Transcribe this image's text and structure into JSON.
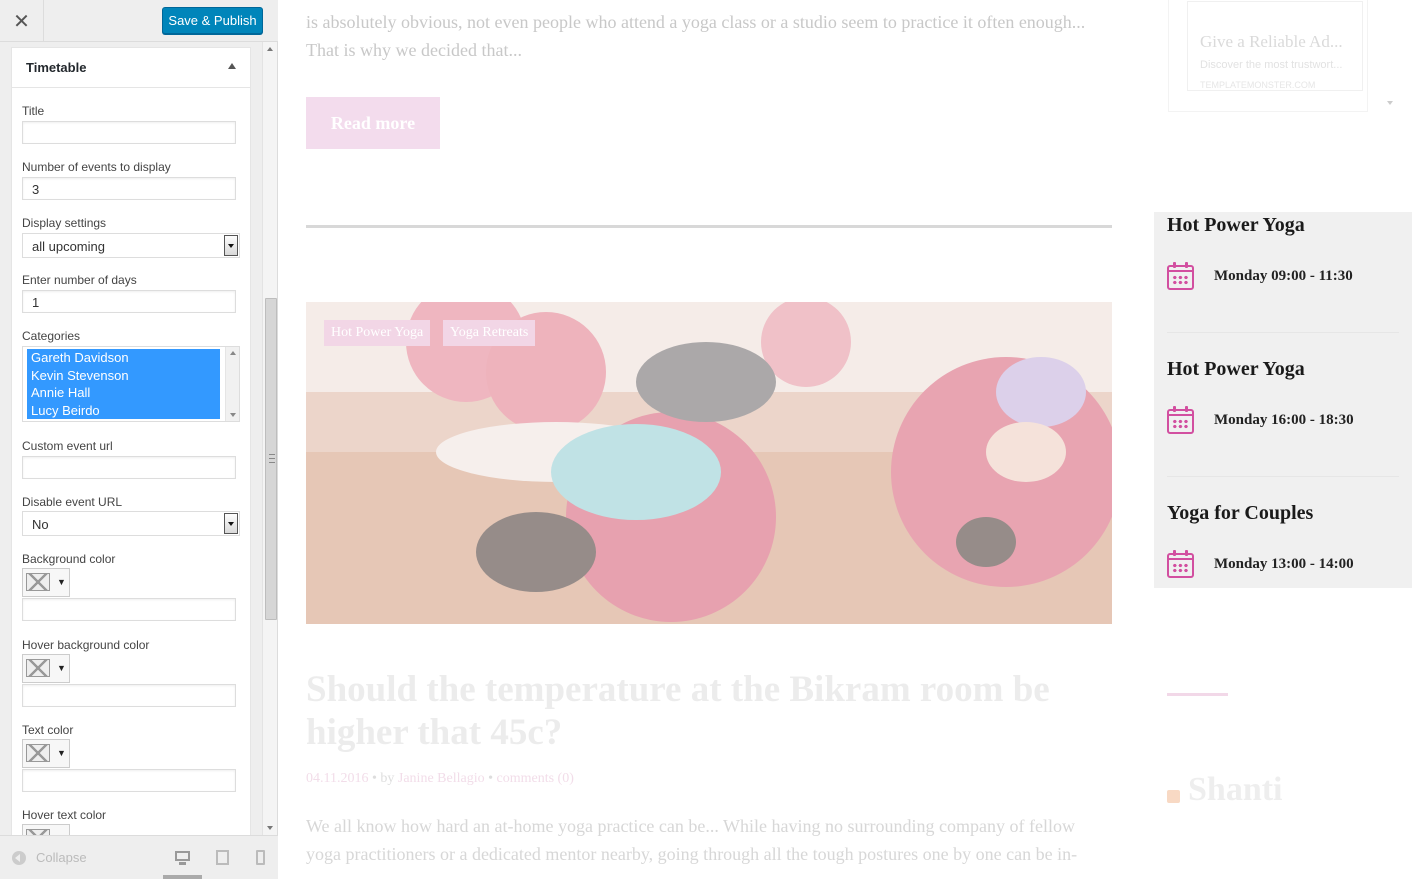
{
  "toolbar": {
    "close_icon": "close-icon",
    "publish_label": "Save & Publish",
    "accent_color": "#0085ba"
  },
  "widget": {
    "title": "Timetable",
    "fields": {
      "title_label": "Title",
      "title_value": "",
      "events_label": "Number of events to display",
      "events_value": "3",
      "display_label": "Display settings",
      "display_value": "all upcoming",
      "days_label": "Enter number of days",
      "days_value": "1",
      "categories_label": "Categories",
      "categories": [
        "Gareth Davidson",
        "Kevin Stevenson",
        "Annie Hall",
        "Lucy Beirdo"
      ],
      "custom_url_label": "Custom event url",
      "custom_url_value": "",
      "disable_url_label": "Disable event URL",
      "disable_url_value": "No",
      "bg_color_label": "Background color",
      "hover_bg_color_label": "Hover background color",
      "text_color_label": "Text color",
      "hover_text_color_label": "Hover text color"
    }
  },
  "footer": {
    "collapse_label": "Collapse",
    "devices": [
      "desktop-icon",
      "tablet-icon",
      "mobile-icon"
    ]
  },
  "preview": {
    "intro_lines": [
      "is absolutely obvious, not even people who attend a yoga class or a studio seem to practice it often enough...",
      "That is why we decided that..."
    ],
    "read_more": "Read more",
    "tags": [
      "Hot Power Yoga",
      "Yoga Retreats"
    ],
    "post_title": "Should the temperature at the Bikram room be higher that 45c?",
    "post_meta": {
      "date": "04.11.2016",
      "by": "by",
      "author": "Janine Bellagio",
      "comments": "comments (0)"
    },
    "excerpt": "We all know how hard an at-home yoga practice can be... While having no surrounding company of fellow yoga practitioners or a dedicated mentor nearby, going through all the tough postures one by one can be in-",
    "ad": {
      "title": "Give a Reliable Ad...",
      "desc": "Discover the most trustwort...",
      "url": "TEMPLATEMONSTER.COM"
    },
    "timetable": [
      {
        "title": "Hot Power Yoga",
        "time": "Monday 09:00 - 11:30"
      },
      {
        "title": "Hot Power Yoga",
        "time": "Monday 16:00 - 18:30"
      },
      {
        "title": "Yoga for Couples",
        "time": "Monday 13:00 - 14:00"
      }
    ],
    "widget_title": "Shanti",
    "icon_color": "#d24fa0"
  }
}
